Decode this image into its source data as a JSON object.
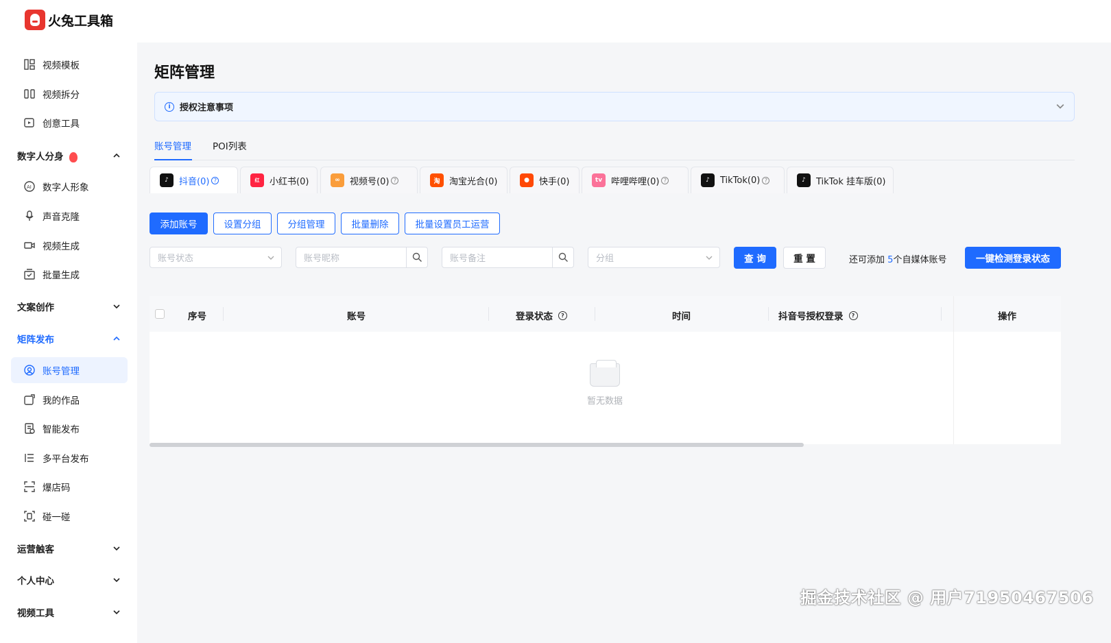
{
  "app": {
    "name": "火兔工具箱"
  },
  "sidebar": {
    "items": [
      {
        "label": "视频模板",
        "icon": "layout-icon"
      },
      {
        "label": "视频拆分",
        "icon": "split-icon"
      },
      {
        "label": "创意工具",
        "icon": "creative-icon"
      },
      {
        "label": "数字人形象",
        "icon": "ai-avatar-icon"
      },
      {
        "label": "声音克隆",
        "icon": "microphone-icon"
      },
      {
        "label": "视频生成",
        "icon": "video-camera-icon"
      },
      {
        "label": "批量生成",
        "icon": "batch-icon"
      },
      {
        "label": "账号管理",
        "icon": "account-icon"
      },
      {
        "label": "我的作品",
        "icon": "works-icon"
      },
      {
        "label": "智能发布",
        "icon": "smart-publish-icon"
      },
      {
        "label": "多平台发布",
        "icon": "multi-platform-icon"
      },
      {
        "label": "爆店码",
        "icon": "scan-icon"
      },
      {
        "label": "碰一碰",
        "icon": "nfc-icon"
      }
    ],
    "groups": [
      {
        "label": "数字人分身",
        "expanded": true
      },
      {
        "label": "文案创作",
        "expanded": false
      },
      {
        "label": "矩阵发布",
        "expanded": true
      },
      {
        "label": "运营触客",
        "expanded": false
      },
      {
        "label": "个人中心",
        "expanded": false
      },
      {
        "label": "视频工具",
        "expanded": false
      }
    ]
  },
  "main": {
    "title": "矩阵管理",
    "notice": "授权注意事项",
    "tabs": [
      {
        "label": "账号管理",
        "active": true
      },
      {
        "label": "POI列表",
        "active": false
      }
    ],
    "platforms": [
      {
        "label": "抖音(0)",
        "icon": "douyin-icon",
        "color": "#111111"
      },
      {
        "label": "小红书(0)",
        "icon": "xiaohongshu-icon",
        "color": "#ff2442"
      },
      {
        "label": "视频号(0)",
        "icon": "channels-icon",
        "color": "#fa9d3b"
      },
      {
        "label": "淘宝光合(0)",
        "icon": "taobao-icon",
        "color": "#ff5000"
      },
      {
        "label": "快手(0)",
        "icon": "kuaishou-icon",
        "color": "#ff4906"
      },
      {
        "label": "哔哩哔哩(0)",
        "icon": "bilibili-icon",
        "color": "#fb7299"
      },
      {
        "label": "TikTok(0)",
        "icon": "tiktok-icon",
        "color": "#111111"
      },
      {
        "label": "TikTok 挂车版(0)",
        "icon": "tiktok-shop-icon",
        "color": "#111111"
      }
    ],
    "actions": {
      "add": "添加账号",
      "set_group": "设置分组",
      "group_manage": "分组管理",
      "batch_delete": "批量删除",
      "batch_staff": "批量设置员工运营"
    },
    "filters": {
      "status_placeholder": "账号状态",
      "nickname_placeholder": "账号昵称",
      "remark_placeholder": "账号备注",
      "group_placeholder": "分组",
      "query": "查 询",
      "reset": "重 置",
      "remain_prefix": "还可添加",
      "remain_count": "5",
      "remain_suffix": "个自媒体账号",
      "check_login": "一键检测登录状态"
    },
    "table": {
      "columns": [
        "序号",
        "账号",
        "登录状态",
        "时间",
        "抖音号授权登录",
        "操作"
      ],
      "empty_text": "暂无数据"
    }
  },
  "watermark": "掘金技术社区 @ 用户71950467506",
  "colors": {
    "accent": "#1f6bff",
    "brand": "#e8362f"
  }
}
